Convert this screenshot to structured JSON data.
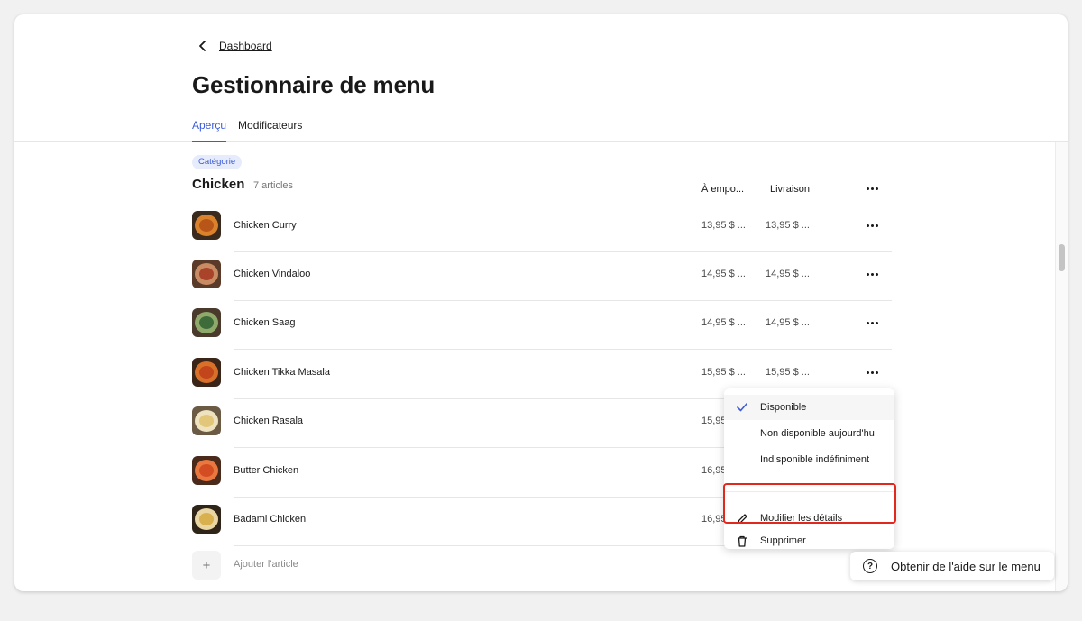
{
  "header": {
    "back_label": "Dashboard",
    "title": "Gestionnaire de menu",
    "tabs": [
      {
        "label": "Aperçu",
        "active": true
      },
      {
        "label": "Modificateurs",
        "active": false
      }
    ]
  },
  "category": {
    "badge": "Catégorie",
    "name": "Chicken",
    "count": "7 articles",
    "columns": {
      "takeout": "À empo...",
      "delivery": "Livraison"
    }
  },
  "items": [
    {
      "name": "Chicken Curry",
      "takeout": "13,95 $ ...",
      "delivery": "13,95 $ ..."
    },
    {
      "name": "Chicken Vindaloo",
      "takeout": "14,95 $ ...",
      "delivery": "14,95 $ ..."
    },
    {
      "name": "Chicken Saag",
      "takeout": "14,95 $ ...",
      "delivery": "14,95 $ ..."
    },
    {
      "name": "Chicken Tikka Masala",
      "takeout": "15,95 $ ...",
      "delivery": "15,95 $ ..."
    },
    {
      "name": "Chicken Rasala",
      "takeout": "15,95",
      "delivery": ""
    },
    {
      "name": "Butter Chicken",
      "takeout": "16,95",
      "delivery": ""
    },
    {
      "name": "Badami Chicken",
      "takeout": "16,95",
      "delivery": ""
    }
  ],
  "add_item_label": "Ajouter l'article",
  "dropdown": {
    "items": [
      {
        "label": "Disponible",
        "icon": "check-icon",
        "selected": true
      },
      {
        "label": "Non disponible aujourd'hu",
        "icon": "",
        "selected": false
      },
      {
        "label": "Indisponible indéfiniment",
        "icon": "",
        "selected": false
      },
      {
        "label": "Modifier les détails",
        "icon": "pencil-icon",
        "selected": false
      },
      {
        "label": "Supprimer",
        "icon": "trash-icon",
        "selected": false
      }
    ]
  },
  "help_button": {
    "label": "Obtenir de l'aide sur le menu",
    "icon": "question-icon"
  },
  "colors": {
    "accent": "#3b5bdb",
    "highlight": "#e0281f"
  }
}
